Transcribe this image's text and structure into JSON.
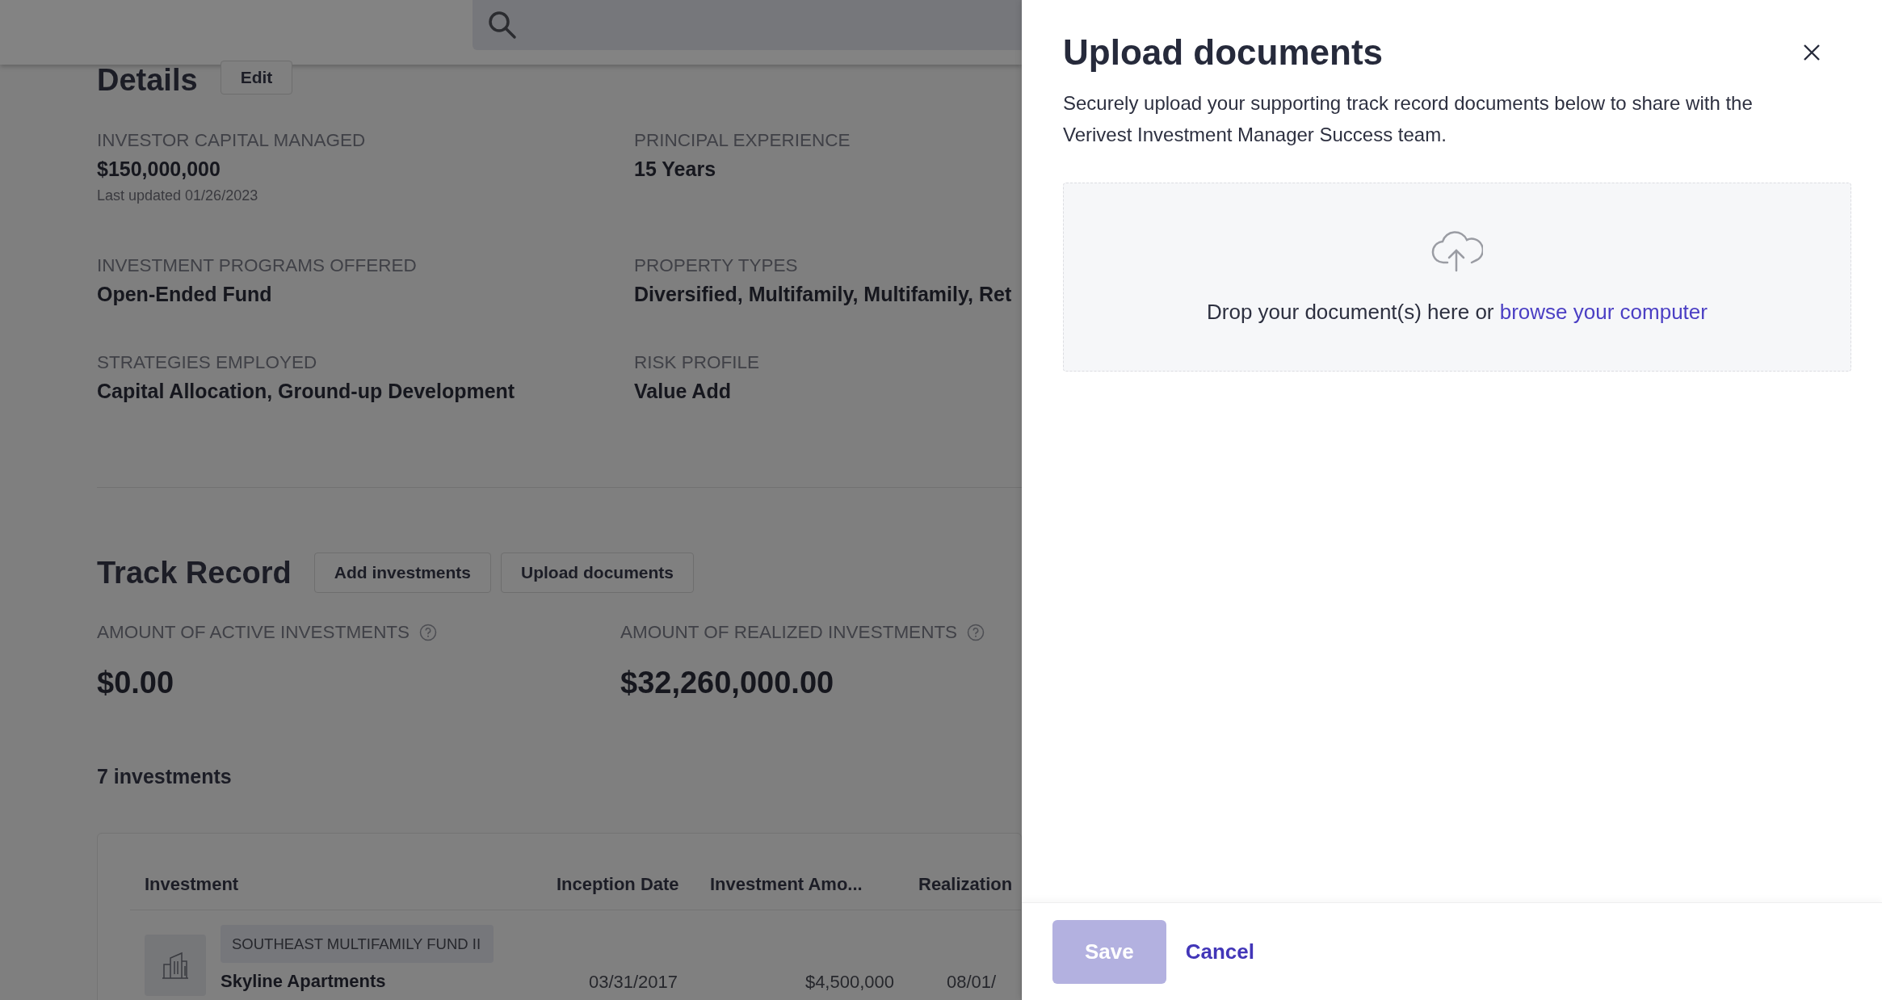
{
  "details": {
    "title": "Details",
    "edit_button": "Edit",
    "fields": [
      {
        "label": "INVESTOR CAPITAL MANAGED",
        "value": "$150,000,000",
        "note": "Last updated 01/26/2023"
      },
      {
        "label": "PRINCIPAL EXPERIENCE",
        "value": "15 Years"
      },
      {
        "label": "INVESTMENT PROGRAMS OFFERED",
        "value": "Open-Ended Fund"
      },
      {
        "label": "PROPERTY TYPES",
        "value": "Diversified, Multifamily, Multifamily, Ret"
      },
      {
        "label": "STRATEGIES EMPLOYED",
        "value": "Capital Allocation, Ground-up Development"
      },
      {
        "label": "RISK PROFILE",
        "value": "Value Add"
      }
    ]
  },
  "track_record": {
    "title": "Track Record",
    "buttons": [
      "Add investments",
      "Upload documents"
    ],
    "stats": [
      {
        "label": "AMOUNT OF ACTIVE INVESTMENTS",
        "value": "$0.00"
      },
      {
        "label": "AMOUNT OF REALIZED INVESTMENTS",
        "value": "$32,260,000.00"
      }
    ],
    "count": "7 investments",
    "table": {
      "columns": [
        "Investment",
        "Inception Date",
        "Investment Amo...",
        "Realization"
      ],
      "rows": [
        {
          "cells": [
            {
              "fund": "SOUTHEAST MULTIFAMILY FUND II",
              "name": "Skyline Apartments"
            },
            "03/31/2017",
            "$4,500,000",
            "08/01/"
          ]
        }
      ]
    }
  },
  "upload_panel": {
    "title": "Upload documents",
    "description": "Securely upload your supporting track record documents below to share with the Verivest Investment Manager Success team.",
    "dropzone": {
      "text": "Drop your document(s) here or",
      "link": "browse your computer"
    },
    "buttons": [
      {
        "label": "Save",
        "kind": "primary",
        "disabled": true
      },
      {
        "label": "Cancel",
        "kind": "link",
        "disabled": false
      }
    ]
  }
}
